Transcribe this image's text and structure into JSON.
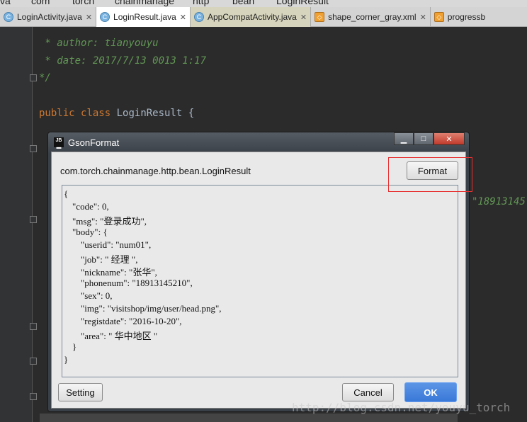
{
  "breadcrumbs": [
    "va",
    "com",
    "torch",
    "chainmanage",
    "http",
    "bean",
    "LoginResult"
  ],
  "tabs": [
    {
      "label": "LoginActivity.java",
      "icon": "class-icon",
      "active": false
    },
    {
      "label": "LoginResult.java",
      "icon": "class-icon",
      "active": true
    },
    {
      "label": "AppCompatActivity.java",
      "icon": "class-locked-icon",
      "active": false
    },
    {
      "label": "shape_corner_gray.xml",
      "icon": "xml-icon",
      "active": false
    },
    {
      "label": "progressb",
      "icon": "xml-icon",
      "active": false
    }
  ],
  "editor": {
    "line_author": " * author: tianyouyu",
    "line_date": " * date: 2017/7/13 0013 1:17",
    "line_end": "*/",
    "kw_public": "public",
    "kw_class": "class",
    "class_name": "LoginResult {",
    "peek": "\"18913145"
  },
  "dialog": {
    "title": "GsonFormat",
    "class_path": "com.torch.chainmanage.http.bean.LoginResult",
    "format_label": "Format",
    "setting_label": "Setting",
    "cancel_label": "Cancel",
    "ok_label": "OK",
    "json_lines": [
      {
        "t": "{",
        "i": 0
      },
      {
        "t": "\"code\": 0,",
        "i": 1
      },
      {
        "t": "\"msg\": \"登录成功\",",
        "i": 1
      },
      {
        "t": "\"body\": {",
        "i": 1
      },
      {
        "t": "\"userid\": \"num01\",",
        "i": 2
      },
      {
        "t": "\"job\": \" 经理 \",",
        "i": 2
      },
      {
        "t": "\"nickname\": \"张华\",",
        "i": 2
      },
      {
        "t": "\"phonenum\": \"18913145210\",",
        "i": 2
      },
      {
        "t": "\"sex\": 0,",
        "i": 2
      },
      {
        "t": "\"img\": \"visitshop/img/user/head.png\",",
        "i": 2
      },
      {
        "t": "\"registdate\": \"2016-10-20\",",
        "i": 2
      },
      {
        "t": "\"area\": \" 华中地区 \"",
        "i": 2
      },
      {
        "t": "}",
        "i": 1
      },
      {
        "t": "}",
        "i": 0
      }
    ]
  },
  "watermark": "http://blog.csdn.net/youyu_torch",
  "colors": {
    "accent": "#3a78d8",
    "highlight": "#e83030"
  }
}
